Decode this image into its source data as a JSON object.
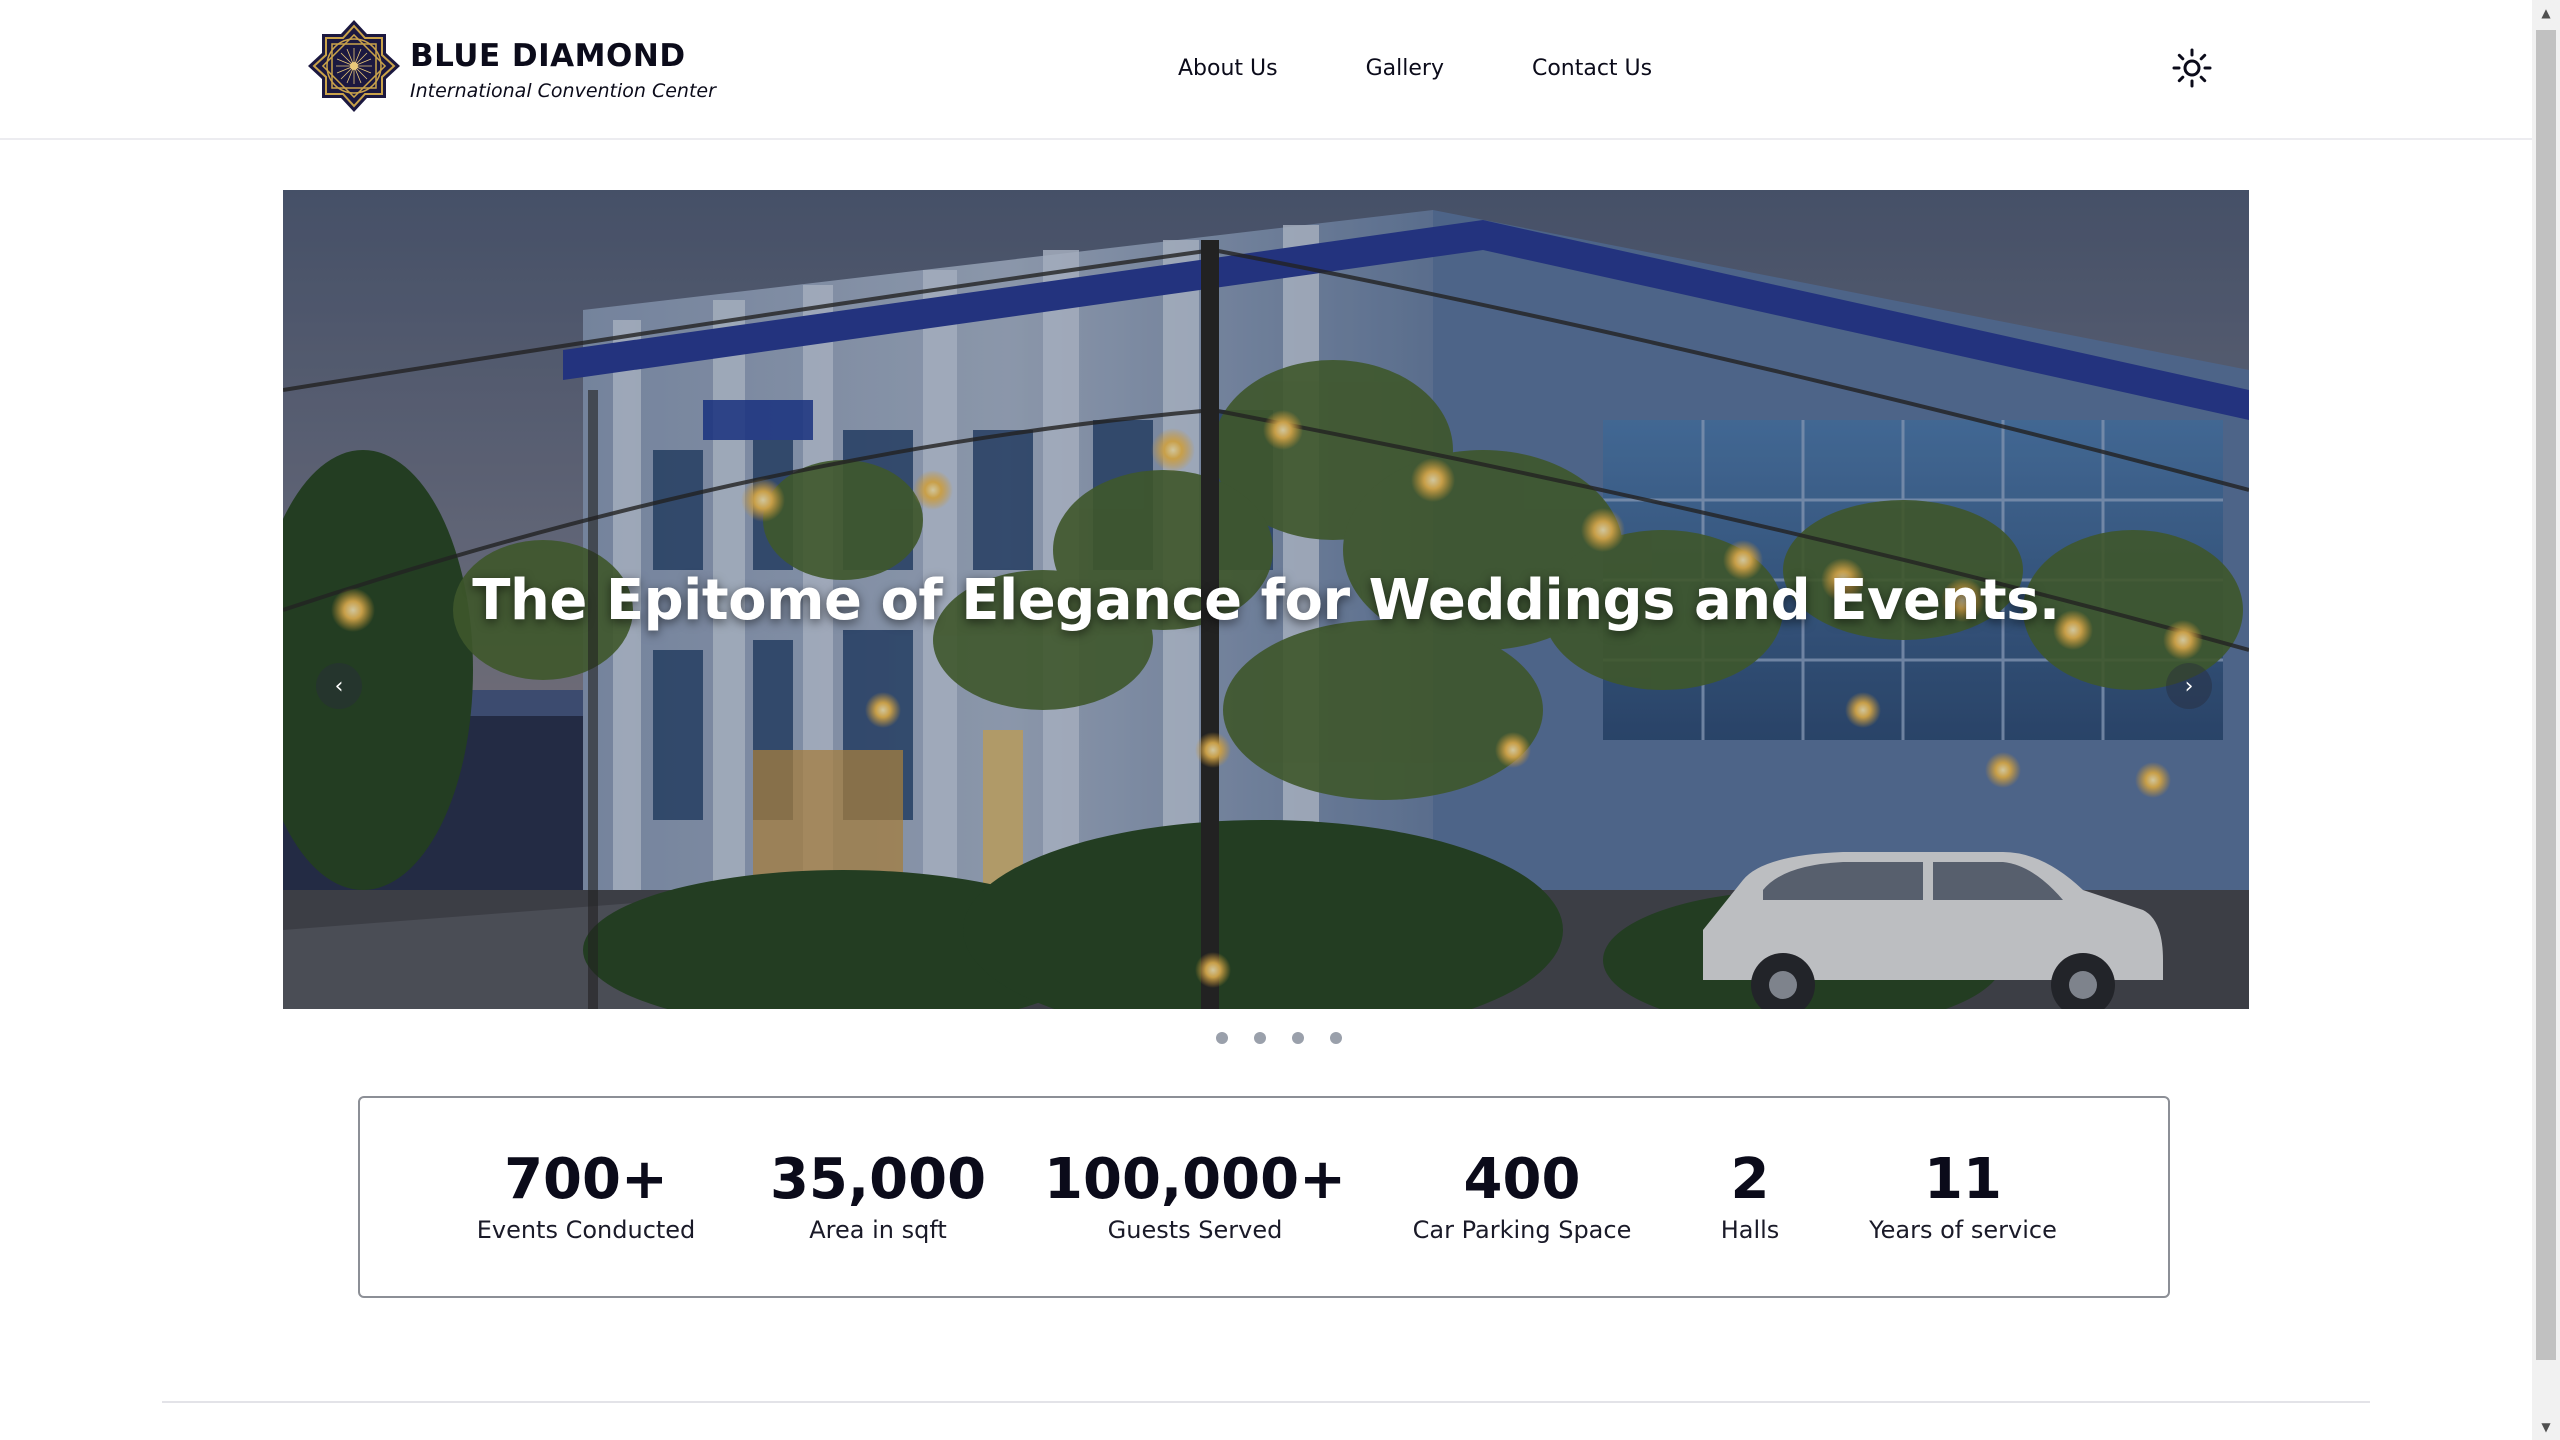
{
  "brand": {
    "name": "BLUE DIAMOND",
    "tagline": "International Convention Center",
    "logo_icon": "diamond-starburst-logo"
  },
  "nav": {
    "items": [
      {
        "label": "About Us"
      },
      {
        "label": "Gallery"
      },
      {
        "label": "Contact Us"
      }
    ],
    "theme_toggle_icon": "sun-icon"
  },
  "hero": {
    "headline": "The Epitome of Elegance for Weddings and Events.",
    "prev_label": "‹",
    "next_label": "›",
    "slides_count": 4,
    "active_slide": 1
  },
  "stats": [
    {
      "value": "700+",
      "label": "Events Conducted"
    },
    {
      "value": "35,000",
      "label": "Area in sqft"
    },
    {
      "value": "100,000+",
      "label": "Guests Served"
    },
    {
      "value": "400",
      "label": "Car Parking Space"
    },
    {
      "value": "2",
      "label": "Halls"
    },
    {
      "value": "11",
      "label": "Years of service"
    }
  ],
  "colors": {
    "text": "#0b0b1a",
    "logo_gold": "#c9a24a",
    "logo_navy": "#1b1840",
    "border": "#8c8f96",
    "dot": "#9aa0ab"
  }
}
